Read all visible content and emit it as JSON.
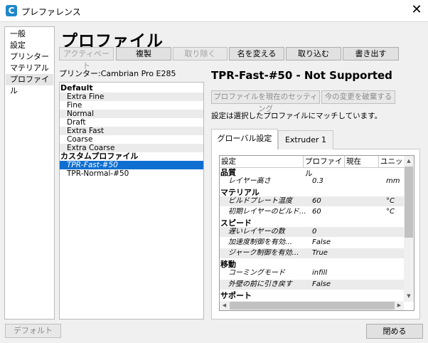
{
  "window": {
    "title": "プレファレンス",
    "close_glyph": "✕",
    "app_icon_letter": "C"
  },
  "nav": {
    "items": [
      "一般",
      "設定",
      "プリンター",
      "マテリアル",
      "プロファイル"
    ],
    "selected": "プロファイル"
  },
  "page_title": "プロファイル",
  "toolbar": {
    "activate": "アクティベート",
    "duplicate": "複製",
    "remove": "取り除く",
    "rename": "名を変える",
    "import": "取り込む",
    "export": "書き出す"
  },
  "printer_label": "プリンター:Cambrian Pro E285",
  "profiles": {
    "default_header": "Default",
    "default_items": [
      "Extra Fine",
      "Fine",
      "Normal",
      "Draft",
      "Extra Fast",
      "Coarse",
      "Extra Coarse"
    ],
    "custom_header": "カスタムプロファイル",
    "custom_items": [
      "TPR-Fast-#50",
      "TPR-Normal-#50"
    ],
    "selected": "TPR-Fast-#50"
  },
  "detail": {
    "heading": "TPR-Fast-#50 - Not Supported",
    "update_button": "プロファイルを現在のセッティング",
    "discard_button": "今の変更を破棄する",
    "match_message": "設定は選択したプロファイルにマッチしています。",
    "tabs": [
      "グローバル設定",
      "Extruder 1"
    ]
  },
  "settings_table": {
    "headers": [
      "設定",
      "プロファイル",
      "現在",
      "ユニット"
    ],
    "groups": [
      {
        "category": "品質",
        "rows": [
          {
            "name": "レイヤー高さ",
            "value": "0.3",
            "unit": "mm"
          }
        ]
      },
      {
        "category": "マテリアル",
        "rows": [
          {
            "name": "ビルドプレート温度",
            "value": "60",
            "unit": "°C"
          },
          {
            "name": "初期レイヤーのビルド…",
            "value": "60",
            "unit": "°C"
          }
        ]
      },
      {
        "category": "スピード",
        "rows": [
          {
            "name": "遅いレイヤーの数",
            "value": "0",
            "unit": ""
          },
          {
            "name": "加速度制御を有効…",
            "value": "False",
            "unit": ""
          },
          {
            "name": "ジャーク制御を有効…",
            "value": "True",
            "unit": ""
          }
        ]
      },
      {
        "category": "移動",
        "rows": [
          {
            "name": "コーミングモード",
            "value": "infill",
            "unit": ""
          },
          {
            "name": "外壁の前に引き戻す",
            "value": "False",
            "unit": ""
          }
        ]
      },
      {
        "category": "サポート",
        "rows": []
      }
    ]
  },
  "bottom": {
    "defaults_button": "デフォルト",
    "close_button": "閉める"
  },
  "colors": {
    "selection": "#0f6fd1",
    "app_icon": "#1e88c9"
  }
}
